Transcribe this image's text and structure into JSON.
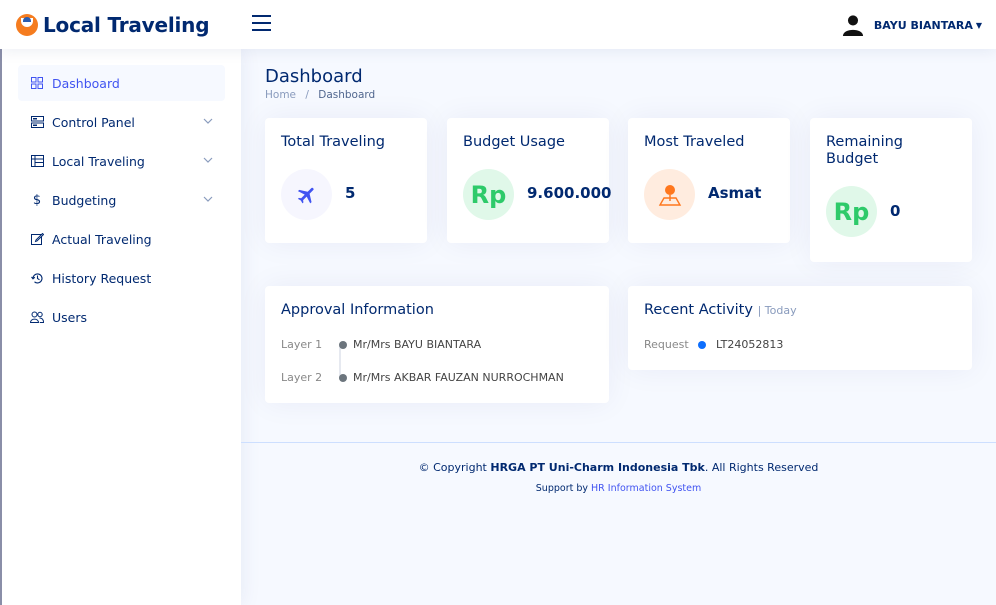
{
  "header": {
    "app_title": "Local Traveling",
    "user_name": "BAYU BIANTARA"
  },
  "sidebar": {
    "items": [
      {
        "label": "Dashboard"
      },
      {
        "label": "Control Panel"
      },
      {
        "label": "Local Traveling"
      },
      {
        "label": "Budgeting"
      },
      {
        "label": "Actual Traveling"
      },
      {
        "label": "History Request"
      },
      {
        "label": "Users"
      }
    ]
  },
  "page": {
    "title": "Dashboard",
    "breadcrumb_home": "Home",
    "breadcrumb_sep": "/",
    "breadcrumb_current": "Dashboard"
  },
  "stats": {
    "total_traveling": {
      "title": "Total Traveling",
      "value": "5"
    },
    "budget_usage": {
      "title": "Budget Usage",
      "icon_text": "Rp",
      "value": "9.600.000"
    },
    "most_traveled": {
      "title": "Most Traveled",
      "value": "Asmat"
    },
    "remaining_budget": {
      "title": "Remaining Budget",
      "icon_text": "Rp",
      "value": "0"
    }
  },
  "approval": {
    "title": "Approval Information",
    "layers": [
      {
        "label": "Layer 1",
        "name": "Mr/Mrs BAYU BIANTARA"
      },
      {
        "label": "Layer 2",
        "name": "Mr/Mrs AKBAR FAUZAN NURROCHMAN"
      }
    ]
  },
  "activity": {
    "title": "Recent Activity",
    "subtitle": "| Today",
    "items": [
      {
        "label": "Request",
        "value": "LT24052813"
      }
    ]
  },
  "footer": {
    "copy_prefix": "© Copyright",
    "company": "HRGA PT Uni-Charm Indonesia Tbk",
    "copy_suffix": ". All Rights Reserved",
    "support_prefix": "Support by",
    "support_link": "HR Information System"
  },
  "colors": {
    "primary": "#4154f1",
    "navy": "#012970",
    "green": "#2eca6a",
    "orange": "#ff771d"
  }
}
